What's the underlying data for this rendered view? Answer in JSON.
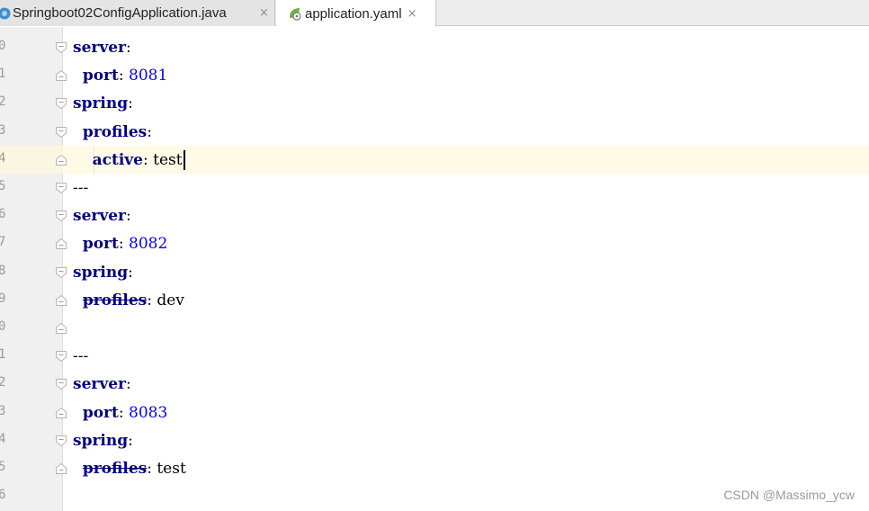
{
  "tabs": [
    {
      "label": "Springboot02ConfigApplication.java",
      "close": "×",
      "icon": "java-class-icon",
      "active": false
    },
    {
      "label": "application.yaml",
      "close": "×",
      "icon": "spring-yaml-icon",
      "active": true
    }
  ],
  "lines": [
    {
      "ln": "0",
      "fold": "open",
      "parts": [
        {
          "t": "server",
          "c": "key"
        },
        {
          "t": ":",
          "c": "plain"
        }
      ]
    },
    {
      "ln": "1",
      "fold": "end",
      "parts": [
        {
          "t": "  "
        },
        {
          "t": "port",
          "c": "key"
        },
        {
          "t": ": ",
          "c": "plain"
        },
        {
          "t": "8081",
          "c": "num"
        }
      ]
    },
    {
      "ln": "2",
      "fold": "open",
      "parts": [
        {
          "t": "spring",
          "c": "key"
        },
        {
          "t": ":",
          "c": "plain"
        }
      ]
    },
    {
      "ln": "3",
      "fold": "open",
      "parts": [
        {
          "t": "  "
        },
        {
          "t": "profiles",
          "c": "key"
        },
        {
          "t": ":",
          "c": "plain"
        }
      ]
    },
    {
      "ln": "4",
      "fold": "end",
      "current": true,
      "parts": [
        {
          "t": "    "
        },
        {
          "t": "active",
          "c": "key"
        },
        {
          "t": ": ",
          "c": "plain"
        },
        {
          "t": "test",
          "c": "plain"
        }
      ]
    },
    {
      "ln": "5",
      "fold": "open",
      "parts": [
        {
          "t": "---",
          "c": "plain"
        }
      ]
    },
    {
      "ln": "6",
      "fold": "open",
      "parts": [
        {
          "t": "server",
          "c": "key"
        },
        {
          "t": ":",
          "c": "plain"
        }
      ]
    },
    {
      "ln": "7",
      "fold": "end",
      "parts": [
        {
          "t": "  "
        },
        {
          "t": "port",
          "c": "key"
        },
        {
          "t": ": ",
          "c": "plain"
        },
        {
          "t": "8082",
          "c": "num"
        }
      ]
    },
    {
      "ln": "8",
      "fold": "open",
      "parts": [
        {
          "t": "spring",
          "c": "key"
        },
        {
          "t": ":",
          "c": "plain"
        }
      ]
    },
    {
      "ln": "9",
      "fold": "end",
      "parts": [
        {
          "t": "  "
        },
        {
          "t": "profiles",
          "c": "key strike"
        },
        {
          "t": ": ",
          "c": "plain"
        },
        {
          "t": "dev",
          "c": "plain"
        }
      ]
    },
    {
      "ln": "0",
      "fold": "end",
      "parts": []
    },
    {
      "ln": "1",
      "fold": "open",
      "parts": [
        {
          "t": "---",
          "c": "plain"
        }
      ]
    },
    {
      "ln": "2",
      "fold": "open",
      "parts": [
        {
          "t": "server",
          "c": "key"
        },
        {
          "t": ":",
          "c": "plain"
        }
      ]
    },
    {
      "ln": "3",
      "fold": "end",
      "parts": [
        {
          "t": "  "
        },
        {
          "t": "port",
          "c": "key"
        },
        {
          "t": ": ",
          "c": "plain"
        },
        {
          "t": "8083",
          "c": "num"
        }
      ]
    },
    {
      "ln": "4",
      "fold": "open",
      "parts": [
        {
          "t": "spring",
          "c": "key"
        },
        {
          "t": ":",
          "c": "plain"
        }
      ]
    },
    {
      "ln": "5",
      "fold": "end",
      "parts": [
        {
          "t": "  "
        },
        {
          "t": "profiles",
          "c": "key strike"
        },
        {
          "t": ": ",
          "c": "plain"
        },
        {
          "t": "test",
          "c": "plain"
        }
      ]
    },
    {
      "ln": "6",
      "fold": "none",
      "parts": []
    }
  ],
  "watermark": "CSDN @Massimo_ycw",
  "colors": {
    "key": "#000080",
    "number": "#0000ff",
    "current_line": "#fefae6",
    "gutter": "#f0f0f0"
  }
}
